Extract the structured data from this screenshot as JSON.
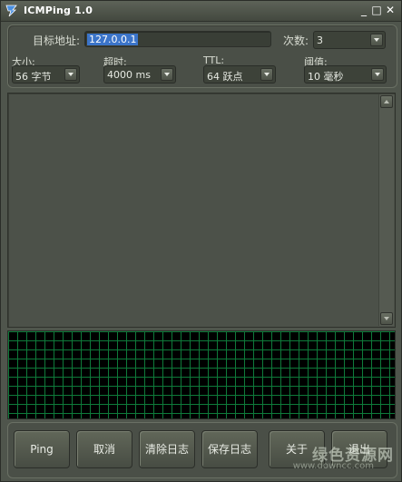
{
  "window": {
    "title": "ICMPing 1.0",
    "minimize_glyph": "_",
    "maximize_glyph": "□",
    "close_glyph": "✕"
  },
  "settings": {
    "target_label": "目标地址:",
    "target_value": "127.0.0.1",
    "count_label": "次数:",
    "count_value": "3",
    "size_label": "大小:",
    "size_value": "56 字节",
    "timeout_label": "超时:",
    "timeout_value": "4000 ms",
    "ttl_label": "TTL:",
    "ttl_value": "64 跃点",
    "threshold_label": "阈值:",
    "threshold_value": "10 毫秒"
  },
  "buttons": {
    "ping": "Ping",
    "cancel": "取消",
    "clear_log": "清除日志",
    "save_log": "保存日志",
    "about": "关于",
    "exit": "退出"
  },
  "watermark": {
    "text": "绿色资源网",
    "url": "www.downcc.com"
  },
  "colors": {
    "graph_background": "#000000",
    "graph_grid": "#0e7a3a",
    "selection": "#3b74c9"
  }
}
